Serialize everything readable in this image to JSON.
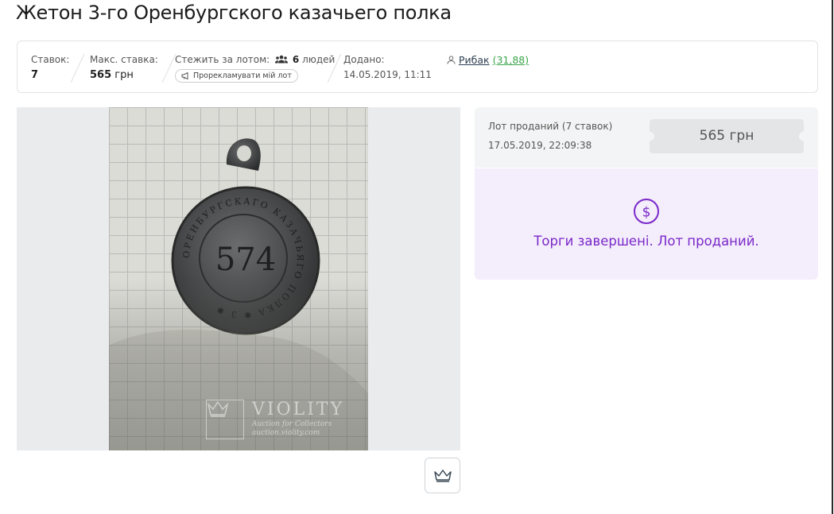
{
  "title": "Жетон 3-го Оренбургского казачьего полка",
  "info": {
    "bids_label": "Ставок:",
    "bids_value": "7",
    "max_bid_label": "Макс. ставка:",
    "max_bid_amount": "565",
    "max_bid_currency": "грн",
    "watch_label": "Стежить за лотом:",
    "watch_count": "6",
    "watch_unit": "людей",
    "promo_label": "Прорекламувати мій лот",
    "added_label": "Додано:",
    "added_value": "14.05.2019, 11:11",
    "seller_name": "Рибак",
    "seller_rating": "(31,88)"
  },
  "photo": {
    "coin_text": "574",
    "watermark_title": "VIOLITY",
    "watermark_sub1": "Auction for Collectors",
    "watermark_sub2": "auction.violity.com"
  },
  "sold": {
    "title": "Лот проданий (7 ставок)",
    "date": "17.05.2019, 22:09:38",
    "price": "565 грн"
  },
  "status": {
    "message": "Торги завершені. Лот проданий."
  },
  "colors": {
    "accent_purple": "#7a28c9",
    "status_bg": "#f4edfb",
    "rating_green": "#3aa54a"
  },
  "icons": [
    "users-icon",
    "megaphone-icon",
    "user-icon",
    "dollar-circle-icon",
    "crown-icon"
  ]
}
